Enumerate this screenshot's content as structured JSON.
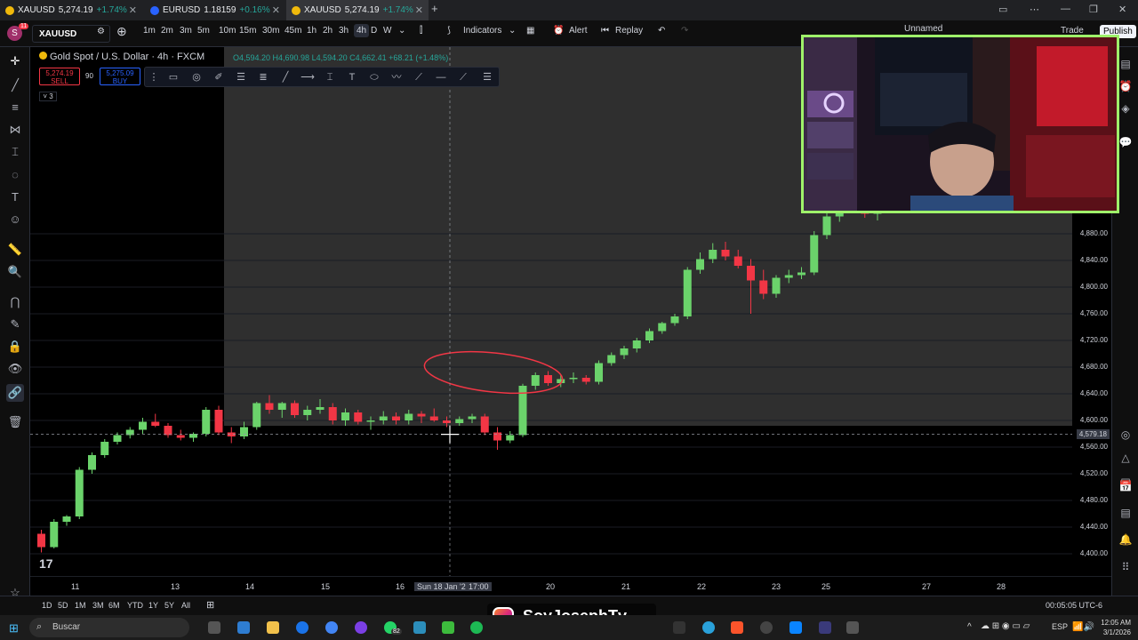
{
  "browser": {
    "tabs": [
      {
        "title": "XAUUSD",
        "price": "5,274.19",
        "change": "+1.74%"
      },
      {
        "title": "EURUSD",
        "price": "1.18159",
        "change": "+0.16%"
      },
      {
        "title": "XAUUSD",
        "price": "5,274.19",
        "change": "+1.74%"
      }
    ]
  },
  "header": {
    "avatar_letter": "S",
    "notification_count": "11",
    "symbol": "XAUUSD",
    "intervals": [
      "1m",
      "2m",
      "3m",
      "5m",
      "10m",
      "15m",
      "30m",
      "45m",
      "1h",
      "2h",
      "3h",
      "4h",
      "D",
      "W"
    ],
    "active_interval": "4h",
    "indicators_label": "Indicators",
    "alert_label": "Alert",
    "replay_label": "Replay",
    "layout_name": "Unnamed",
    "trade_label": "Trade",
    "publish_label": "Publish"
  },
  "legend": {
    "title": "Gold Spot / U.S. Dollar · 4h · FXCM",
    "ohlc": "O4,594.20 H4,690.98 L4,594.20 C4,662.41 +68.21 (+1.48%)",
    "sell_price": "5,274.19",
    "sell_label": "SELL",
    "spread": "90",
    "buy_price": "5,275.09",
    "buy_label": "BUY",
    "indicator_count": "3"
  },
  "chart_data": {
    "type": "candlestick",
    "symbol": "XAUUSD",
    "interval": "4h",
    "price_ticks": [
      "4,880.00",
      "4,840.00",
      "4,800.00",
      "4,760.00",
      "4,720.00",
      "4,680.00",
      "4,640.00",
      "4,600.00",
      "4,560.00",
      "4,520.00",
      "4,480.00",
      "4,440.00",
      "4,400.00"
    ],
    "crosshair_price": "4,579.18",
    "time_ticks": [
      "11",
      "13",
      "14",
      "15",
      "16",
      "Sun 18 Jan '26",
      "17:00",
      "20",
      "21",
      "22",
      "23",
      "25",
      "27",
      "28"
    ],
    "candles": [
      {
        "o": 4430,
        "h": 4436,
        "l": 4402,
        "c": 4410
      },
      {
        "o": 4410,
        "h": 4452,
        "l": 4408,
        "c": 4448
      },
      {
        "o": 4448,
        "h": 4458,
        "l": 4442,
        "c": 4456
      },
      {
        "o": 4456,
        "h": 4530,
        "l": 4452,
        "c": 4526
      },
      {
        "o": 4526,
        "h": 4552,
        "l": 4520,
        "c": 4548
      },
      {
        "o": 4548,
        "h": 4572,
        "l": 4544,
        "c": 4568
      },
      {
        "o": 4568,
        "h": 4582,
        "l": 4564,
        "c": 4578
      },
      {
        "o": 4578,
        "h": 4590,
        "l": 4573,
        "c": 4586
      },
      {
        "o": 4586,
        "h": 4604,
        "l": 4580,
        "c": 4598
      },
      {
        "o": 4598,
        "h": 4610,
        "l": 4590,
        "c": 4592
      },
      {
        "o": 4592,
        "h": 4596,
        "l": 4574,
        "c": 4578
      },
      {
        "o": 4578,
        "h": 4586,
        "l": 4570,
        "c": 4574
      },
      {
        "o": 4574,
        "h": 4582,
        "l": 4568,
        "c": 4580
      },
      {
        "o": 4580,
        "h": 4620,
        "l": 4576,
        "c": 4616
      },
      {
        "o": 4616,
        "h": 4622,
        "l": 4578,
        "c": 4582
      },
      {
        "o": 4582,
        "h": 4590,
        "l": 4566,
        "c": 4576
      },
      {
        "o": 4576,
        "h": 4598,
        "l": 4572,
        "c": 4590
      },
      {
        "o": 4590,
        "h": 4628,
        "l": 4586,
        "c": 4626
      },
      {
        "o": 4626,
        "h": 4638,
        "l": 4610,
        "c": 4616
      },
      {
        "o": 4616,
        "h": 4628,
        "l": 4604,
        "c": 4626
      },
      {
        "o": 4626,
        "h": 4630,
        "l": 4604,
        "c": 4608
      },
      {
        "o": 4608,
        "h": 4622,
        "l": 4600,
        "c": 4616
      },
      {
        "o": 4616,
        "h": 4632,
        "l": 4610,
        "c": 4620
      },
      {
        "o": 4620,
        "h": 4626,
        "l": 4594,
        "c": 4600
      },
      {
        "o": 4600,
        "h": 4618,
        "l": 4592,
        "c": 4612
      },
      {
        "o": 4612,
        "h": 4616,
        "l": 4594,
        "c": 4598
      },
      {
        "o": 4598,
        "h": 4606,
        "l": 4586,
        "c": 4600
      },
      {
        "o": 4600,
        "h": 4614,
        "l": 4594,
        "c": 4606
      },
      {
        "o": 4606,
        "h": 4612,
        "l": 4594,
        "c": 4600
      },
      {
        "o": 4600,
        "h": 4616,
        "l": 4594,
        "c": 4610
      },
      {
        "o": 4610,
        "h": 4614,
        "l": 4596,
        "c": 4606
      },
      {
        "o": 4606,
        "h": 4618,
        "l": 4598,
        "c": 4600
      },
      {
        "o": 4600,
        "h": 4606,
        "l": 4590,
        "c": 4596
      },
      {
        "o": 4596,
        "h": 4606,
        "l": 4592,
        "c": 4602
      },
      {
        "o": 4602,
        "h": 4610,
        "l": 4596,
        "c": 4606
      },
      {
        "o": 4606,
        "h": 4610,
        "l": 4578,
        "c": 4582
      },
      {
        "o": 4582,
        "h": 4590,
        "l": 4556,
        "c": 4570
      },
      {
        "o": 4570,
        "h": 4584,
        "l": 4566,
        "c": 4578
      },
      {
        "o": 4578,
        "h": 4655,
        "l": 4575,
        "c": 4652
      },
      {
        "o": 4652,
        "h": 4672,
        "l": 4646,
        "c": 4668
      },
      {
        "o": 4668,
        "h": 4674,
        "l": 4652,
        "c": 4656
      },
      {
        "o": 4656,
        "h": 4668,
        "l": 4650,
        "c": 4662
      },
      {
        "o": 4662,
        "h": 4672,
        "l": 4656,
        "c": 4664
      },
      {
        "o": 4664,
        "h": 4668,
        "l": 4654,
        "c": 4658
      },
      {
        "o": 4658,
        "h": 4690,
        "l": 4654,
        "c": 4686
      },
      {
        "o": 4686,
        "h": 4702,
        "l": 4682,
        "c": 4698
      },
      {
        "o": 4698,
        "h": 4712,
        "l": 4692,
        "c": 4708
      },
      {
        "o": 4708,
        "h": 4724,
        "l": 4702,
        "c": 4720
      },
      {
        "o": 4720,
        "h": 4738,
        "l": 4716,
        "c": 4734
      },
      {
        "o": 4734,
        "h": 4748,
        "l": 4730,
        "c": 4746
      },
      {
        "o": 4746,
        "h": 4760,
        "l": 4742,
        "c": 4756
      },
      {
        "o": 4756,
        "h": 4830,
        "l": 4752,
        "c": 4826
      },
      {
        "o": 4826,
        "h": 4852,
        "l": 4820,
        "c": 4842
      },
      {
        "o": 4842,
        "h": 4866,
        "l": 4836,
        "c": 4856
      },
      {
        "o": 4856,
        "h": 4868,
        "l": 4840,
        "c": 4846
      },
      {
        "o": 4846,
        "h": 4856,
        "l": 4828,
        "c": 4832
      },
      {
        "o": 4832,
        "h": 4842,
        "l": 4760,
        "c": 4810
      },
      {
        "o": 4810,
        "h": 4826,
        "l": 4782,
        "c": 4790
      },
      {
        "o": 4790,
        "h": 4818,
        "l": 4784,
        "c": 4814
      },
      {
        "o": 4814,
        "h": 4826,
        "l": 4806,
        "c": 4818
      },
      {
        "o": 4818,
        "h": 4830,
        "l": 4812,
        "c": 4822
      },
      {
        "o": 4822,
        "h": 4884,
        "l": 4818,
        "c": 4878
      },
      {
        "o": 4878,
        "h": 4912,
        "l": 4872,
        "c": 4906
      },
      {
        "o": 4906,
        "h": 4932,
        "l": 4898,
        "c": 4924
      },
      {
        "o": 4924,
        "h": 4936,
        "l": 4914,
        "c": 4930
      },
      {
        "o": 4930,
        "h": 4934,
        "l": 4904,
        "c": 4910
      },
      {
        "o": 4910,
        "h": 4922,
        "l": 4900,
        "c": 4918
      },
      {
        "o": 4918,
        "h": 4930,
        "l": 4912,
        "c": 4926
      }
    ]
  },
  "bottom": {
    "ranges": [
      "1D",
      "5D",
      "1M",
      "3M",
      "6M",
      "YTD",
      "1Y",
      "5Y",
      "All"
    ],
    "clock": "00:05:05 UTC-6"
  },
  "taskbar": {
    "search_label": "Buscar",
    "lang": "ESP",
    "time": "12:05 AM",
    "date": "3/1/2026",
    "whatsapp_badge": "82"
  },
  "overlay": {
    "watermark": "SoyJosephTv"
  },
  "colors": {
    "up": "#26a69a",
    "up_candle": "#6bd36b",
    "down": "#f23645",
    "accent": "#2962ff",
    "cam_border": "#9ff26a"
  }
}
